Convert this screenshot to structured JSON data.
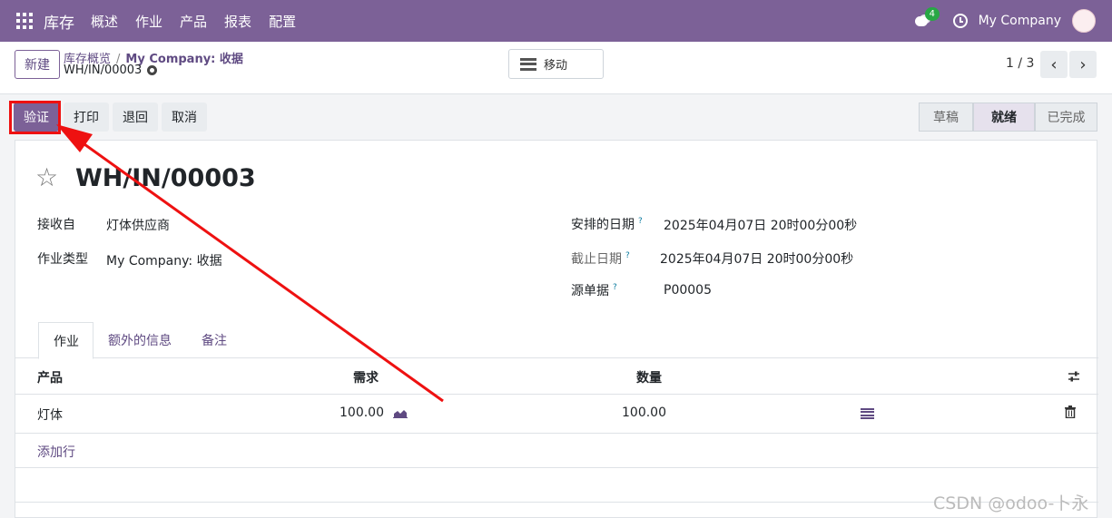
{
  "topbar": {
    "app_title": "库存",
    "menu": [
      "概述",
      "作业",
      "产品",
      "报表",
      "配置"
    ],
    "chat_badge": "4",
    "company": "My Company"
  },
  "control": {
    "new_label": "新建",
    "breadcrumb_parent": "库存概览",
    "breadcrumb_separator": "/",
    "breadcrumb_current": "My Company: 收据",
    "record_ref": "WH/IN/00003",
    "move_label": "移动",
    "pager": "1 / 3",
    "pager_prev": "‹",
    "pager_next": "›"
  },
  "actions": {
    "validate": "验证",
    "print": "打印",
    "return": "退回",
    "cancel": "取消"
  },
  "statusbar": {
    "draft": "草稿",
    "ready": "就绪",
    "done": "已完成"
  },
  "form": {
    "title": "WH/IN/00003",
    "receive_from_label": "接收自",
    "receive_from_value": "灯体供应商",
    "operation_type_label": "作业类型",
    "operation_type_value": "My Company: 收据",
    "scheduled_date_label": "安排的日期",
    "scheduled_date_value": "2025年04月07日 20时00分00秒",
    "deadline_label": "截止日期",
    "deadline_value": "2025年04月07日 20时00分00秒",
    "source_label": "源单据",
    "source_value": "P00005",
    "help_mark": "?"
  },
  "tabs": [
    "作业",
    "额外的信息",
    "备注"
  ],
  "table": {
    "headers": {
      "product": "产品",
      "demand": "需求",
      "quantity": "数量"
    },
    "rows": [
      {
        "product": "灯体",
        "demand": "100.00",
        "quantity": "100.00"
      }
    ],
    "add_line": "添加行"
  },
  "watermark": "CSDN @odoo-卜永",
  "colors": {
    "brand": "#7c6197",
    "annotation": "#e11111"
  }
}
